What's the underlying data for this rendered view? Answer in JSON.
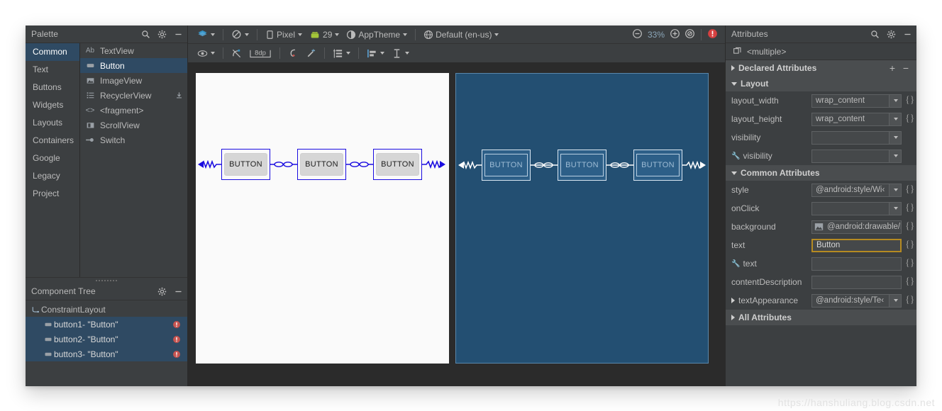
{
  "palette": {
    "title": "Palette",
    "search_icon": "search-icon",
    "gear_icon": "gear-icon",
    "minimize_icon": "minimize-icon",
    "categories": [
      {
        "label": "Common",
        "selected": true
      },
      {
        "label": "Text",
        "selected": false
      },
      {
        "label": "Buttons",
        "selected": false
      },
      {
        "label": "Widgets",
        "selected": false
      },
      {
        "label": "Layouts",
        "selected": false
      },
      {
        "label": "Containers",
        "selected": false
      },
      {
        "label": "Google",
        "selected": false
      },
      {
        "label": "Legacy",
        "selected": false
      },
      {
        "label": "Project",
        "selected": false
      }
    ],
    "items": [
      {
        "label": "TextView",
        "icon": "textview-icon",
        "selected": false,
        "download": false
      },
      {
        "label": "Button",
        "icon": "button-icon",
        "selected": true,
        "download": false
      },
      {
        "label": "ImageView",
        "icon": "imageview-icon",
        "selected": false,
        "download": false
      },
      {
        "label": "RecyclerView",
        "icon": "recyclerview-icon",
        "selected": false,
        "download": true
      },
      {
        "label": "<fragment>",
        "icon": "fragment-icon",
        "selected": false,
        "download": false
      },
      {
        "label": "ScrollView",
        "icon": "scrollview-icon",
        "selected": false,
        "download": false
      },
      {
        "label": "Switch",
        "icon": "switch-icon",
        "selected": false,
        "download": false
      }
    ]
  },
  "component_tree": {
    "title": "Component Tree",
    "gear_icon": "gear-icon",
    "minimize_icon": "minimize-icon",
    "root": {
      "label": "ConstraintLayout",
      "icon": "constraintlayout-icon"
    },
    "nodes": [
      {
        "label": "button1- \"Button\"",
        "icon": "button-icon",
        "error": true,
        "selected": true
      },
      {
        "label": "button2- \"Button\"",
        "icon": "button-icon",
        "error": true,
        "selected": true
      },
      {
        "label": "button3- \"Button\"",
        "icon": "button-icon",
        "error": true,
        "selected": true
      }
    ]
  },
  "toolbar": {
    "row1": [
      {
        "name": "design-mode-button",
        "icon": "layers-icon",
        "label": "",
        "caret": true
      },
      {
        "sep": true
      },
      {
        "name": "orientation-button",
        "icon": "rotate-icon",
        "label": "",
        "caret": true
      },
      {
        "sep": true
      },
      {
        "name": "device-button",
        "icon": "phone-icon",
        "label": "Pixel",
        "caret": true
      },
      {
        "name": "api-button",
        "icon": "android-icon",
        "label": "29",
        "caret": true
      },
      {
        "name": "theme-button",
        "icon": "theme-icon",
        "label": "AppTheme",
        "caret": true
      },
      {
        "sep": true
      },
      {
        "name": "locale-button",
        "icon": "globe-icon",
        "label": "Default (en-us)",
        "caret": true
      }
    ],
    "zoom_out_icon": "zoom-out-icon",
    "zoom_level": "33%",
    "zoom_in_icon": "zoom-in-icon",
    "zoom_fit_icon": "zoom-fit-icon",
    "error_icon": "error-icon",
    "row2": [
      {
        "name": "view-options-button",
        "icon": "eye-icon",
        "caret": true
      },
      {
        "sep": true
      },
      {
        "name": "clear-constraints-button",
        "icon": "clear-constraints-icon",
        "caret": false
      },
      {
        "name": "default-margin-button",
        "icon": "margin-icon",
        "label": "8dp",
        "caret": false
      },
      {
        "sep": true
      },
      {
        "name": "toggle-autoconnect-button",
        "icon": "autoconnect-off-icon",
        "caret": false
      },
      {
        "name": "infer-constraints-button",
        "icon": "magic-wand-icon",
        "caret": false
      },
      {
        "sep": true
      },
      {
        "name": "guidelines-button",
        "icon": "guidelines-icon",
        "caret": true
      },
      {
        "sep": true
      },
      {
        "name": "align-button",
        "icon": "align-icon",
        "caret": true
      },
      {
        "name": "pack-button",
        "icon": "pack-icon",
        "caret": true
      }
    ]
  },
  "canvas": {
    "design_buttons": [
      {
        "label": "BUTTON"
      },
      {
        "label": "BUTTON"
      },
      {
        "label": "BUTTON"
      }
    ],
    "blueprint_buttons": [
      {
        "label": "BUTTON"
      },
      {
        "label": "BUTTON"
      },
      {
        "label": "BUTTON"
      }
    ],
    "design_bg": "#fafafa",
    "blueprint_bg": "#234f72",
    "constraint_color": "#1a0ce0"
  },
  "attributes": {
    "title": "Attributes",
    "search_icon": "search-icon",
    "gear_icon": "gear-icon",
    "minimize_icon": "minimize-icon",
    "selection_label": "<multiple>",
    "selection_icon": "multiselect-icon",
    "declared": {
      "label": "Declared Attributes",
      "expanded": false,
      "add_label": "+",
      "remove_label": "−"
    },
    "sections": [
      {
        "label": "Layout",
        "expanded": true,
        "rows": [
          {
            "name": "layout_width",
            "value": "wrap_content",
            "dropdown": true,
            "brace": true,
            "wrench": false,
            "focused": false,
            "icon": null
          },
          {
            "name": "layout_height",
            "value": "wrap_content",
            "dropdown": true,
            "brace": true,
            "wrench": false,
            "focused": false,
            "icon": null
          },
          {
            "name": "visibility",
            "value": "",
            "dropdown": true,
            "brace": false,
            "wrench": false,
            "focused": false,
            "icon": null
          },
          {
            "name": "visibility",
            "value": "",
            "dropdown": true,
            "brace": false,
            "wrench": true,
            "focused": false,
            "icon": null
          }
        ]
      },
      {
        "label": "Common Attributes",
        "expanded": true,
        "rows": [
          {
            "name": "style",
            "value": "@android:style/Wi‹",
            "dropdown": true,
            "brace": true,
            "wrench": false,
            "focused": false,
            "icon": null
          },
          {
            "name": "onClick",
            "value": "",
            "dropdown": true,
            "brace": true,
            "wrench": false,
            "focused": false,
            "icon": null
          },
          {
            "name": "background",
            "value": "@android:drawable/ɓ",
            "dropdown": false,
            "brace": true,
            "wrench": false,
            "focused": false,
            "icon": "image-icon"
          },
          {
            "name": "text",
            "value": "Button",
            "dropdown": false,
            "brace": true,
            "wrench": false,
            "focused": true,
            "icon": null
          },
          {
            "name": "text",
            "value": "",
            "dropdown": false,
            "brace": true,
            "wrench": true,
            "focused": false,
            "icon": null
          },
          {
            "name": "contentDescription",
            "value": "",
            "dropdown": false,
            "brace": true,
            "wrench": false,
            "focused": false,
            "icon": null
          },
          {
            "name": "textAppearance",
            "value": "@android:style/Te‹",
            "dropdown": true,
            "brace": true,
            "wrench": false,
            "focused": false,
            "icon": null,
            "tri": true
          }
        ]
      }
    ],
    "all_attributes": {
      "label": "All Attributes",
      "expanded": false
    }
  },
  "watermark": "https://hanshuliang.blog.csdn.net"
}
